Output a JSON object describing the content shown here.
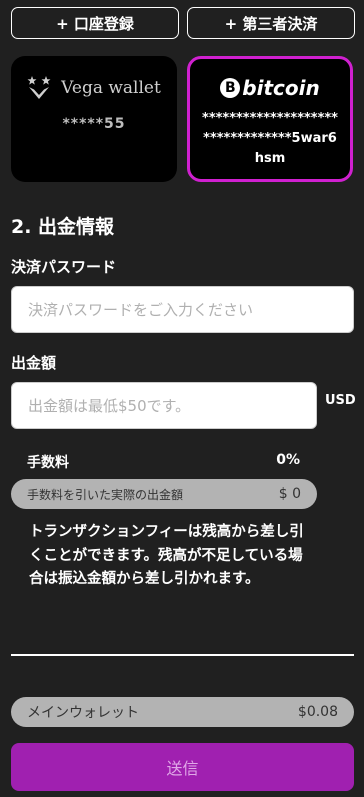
{
  "top_buttons": {
    "account_registration": "+ 口座登録",
    "third_party_payment": "+ 第三者決済"
  },
  "cards": {
    "vega": {
      "name": "Vega wallet",
      "number": "*****55",
      "icon": "vega-star-logo"
    },
    "bitcoin": {
      "name": "bitcoin",
      "symbol": "B",
      "address": "*********************************5war6hsm",
      "selected": true,
      "border_color": "#d020d0"
    }
  },
  "section": {
    "title": "2. 出金情報"
  },
  "password": {
    "label": "決済パスワード",
    "placeholder": "決済パスワードをご入力ください"
  },
  "amount": {
    "label": "出金額",
    "placeholder": "出金額は最低$50です。",
    "currency": "USD"
  },
  "fee": {
    "label": "手数料",
    "value": "0%",
    "net_label": "手数料を引いた実際の出金額",
    "net_value": "$ 0"
  },
  "notice": "トランザクションフィーは残高から差し引くことができます。残高が不足している場合は振込金額から差し引かれます。",
  "wallet": {
    "label": "メインウォレット",
    "value": "$0.08"
  },
  "submit": {
    "label": "送信",
    "color": "#a020b0"
  }
}
